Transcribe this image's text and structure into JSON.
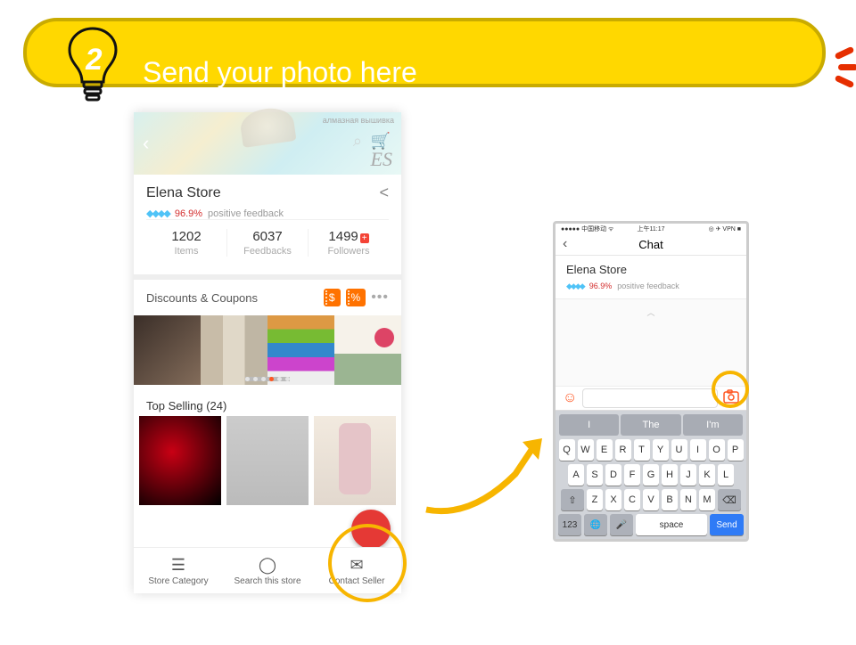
{
  "banner": {
    "text": "Send your photo here",
    "step": "2"
  },
  "store": {
    "brand_top": "алмазная вышивка",
    "brand_logo": "ES",
    "name": "Elena Store",
    "diamonds": "◆◆◆◆",
    "pct": "96.9%",
    "feedback": "positive feedback"
  },
  "stats": {
    "items": {
      "n": "1202",
      "l": "Items"
    },
    "feedbacks": {
      "n": "6037",
      "l": "Feedbacks"
    },
    "followers": {
      "n": "1499",
      "l": "Followers"
    }
  },
  "discounts": {
    "label": "Discounts & Coupons",
    "chip1": "$",
    "chip2": "%"
  },
  "top_selling": "Top Selling (24)",
  "bottom": {
    "cat": "Store Category",
    "search": "Search this store",
    "contact": "Contact Seller"
  },
  "chat": {
    "status": {
      "carrier": "●●●●● 中国移动 ᯤ",
      "time": "上午11:17",
      "right": "◎ ✈ VPN ■"
    },
    "title": "Chat",
    "suggestions": [
      "I",
      "The",
      "I'm"
    ],
    "rows": [
      [
        "Q",
        "W",
        "E",
        "R",
        "T",
        "Y",
        "U",
        "I",
        "O",
        "P"
      ],
      [
        "A",
        "S",
        "D",
        "F",
        "G",
        "H",
        "J",
        "K",
        "L"
      ],
      [
        "Z",
        "X",
        "C",
        "V",
        "B",
        "N",
        "M"
      ]
    ],
    "bottom_keys": {
      "num": "123",
      "space": "space",
      "send": "Send"
    }
  }
}
